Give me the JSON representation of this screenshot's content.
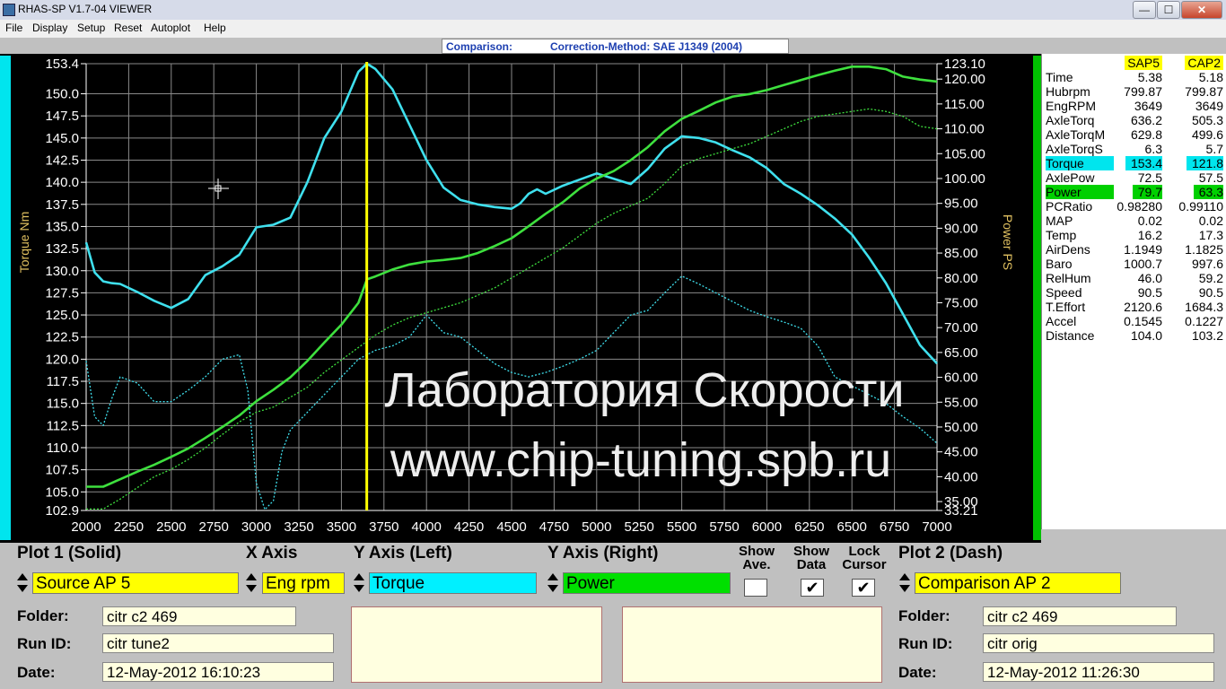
{
  "window": {
    "title": "RHAS-SP V1.7-04  VIEWER",
    "buttons": {
      "minimize": "—",
      "maximize": "☐",
      "close": "✕"
    }
  },
  "menu": [
    "File",
    "Display",
    "Setup",
    "Reset",
    "Autoplot",
    "Help"
  ],
  "heading": {
    "comparison": "Comparison:",
    "method": "Correction-Method: SAE J1349 (2004)"
  },
  "chart_data": {
    "type": "line",
    "xlabel": "",
    "ylabel_left": "Torque Nm",
    "ylabel_right": "Power PS",
    "xlim": [
      2000,
      7000
    ],
    "ylim_left": [
      102.9,
      153.4
    ],
    "ylim_right": [
      33.21,
      123.1
    ],
    "x_ticks": [
      "2000",
      "2250",
      "2500",
      "2750",
      "3000",
      "3250",
      "3500",
      "3750",
      "4000",
      "4250",
      "4500",
      "4750",
      "5000",
      "5250",
      "5500",
      "5750",
      "6000",
      "6250",
      "6500",
      "6750",
      "7000"
    ],
    "y_left_ticks": [
      "153.4",
      "150.0",
      "147.5",
      "145.0",
      "142.5",
      "140.0",
      "137.5",
      "135.0",
      "132.5",
      "130.0",
      "127.5",
      "125.0",
      "122.5",
      "120.0",
      "117.5",
      "115.0",
      "112.5",
      "110.0",
      "107.5",
      "105.0",
      "102.9"
    ],
    "y_right_ticks": [
      "123.10",
      "120.00",
      "115.00",
      "110.00",
      "105.00",
      "100.00",
      "95.00",
      "90.00",
      "85.00",
      "80.00",
      "75.00",
      "70.00",
      "65.00",
      "60.00",
      "55.00",
      "50.00",
      "45.00",
      "40.00",
      "35.00",
      "33.21"
    ],
    "cursor_rpm": 3649,
    "grid": true,
    "series": [
      {
        "name": "Torque",
        "axis": "left",
        "style": "solid",
        "color": "#3fe0ee",
        "x": [
          2000,
          2050,
          2100,
          2150,
          2200,
          2300,
          2400,
          2500,
          2600,
          2700,
          2800,
          2900,
          3000,
          3100,
          3200,
          3300,
          3400,
          3500,
          3600,
          3650,
          3700,
          3800,
          3900,
          4000,
          4100,
          4200,
          4300,
          4400,
          4500,
          4550,
          4600,
          4650,
          4700,
          4800,
          4900,
          5000,
          5100,
          5200,
          5300,
          5400,
          5500,
          5600,
          5700,
          5800,
          5900,
          6000,
          6100,
          6200,
          6300,
          6400,
          6500,
          6600,
          6700,
          6800,
          6900,
          7000
        ],
        "y": [
          133.2,
          129.8,
          128.8,
          128.6,
          128.5,
          127.6,
          126.6,
          125.8,
          126.8,
          129.5,
          130.5,
          131.8,
          134.9,
          135.2,
          136.0,
          140.0,
          145.0,
          148.0,
          152.5,
          153.4,
          152.8,
          150.5,
          146.5,
          142.5,
          139.4,
          138.0,
          137.5,
          137.2,
          137.0,
          137.6,
          138.7,
          139.2,
          138.7,
          139.6,
          140.3,
          141.0,
          140.4,
          139.8,
          141.5,
          143.8,
          145.2,
          145.0,
          144.5,
          143.6,
          142.8,
          141.6,
          139.8,
          138.7,
          137.4,
          135.9,
          134.1,
          131.5,
          128.6,
          125.1,
          121.6,
          119.5
        ]
      },
      {
        "name": "Power",
        "axis": "right",
        "style": "solid",
        "color": "#3ee03e",
        "x": [
          2000,
          2100,
          2200,
          2300,
          2400,
          2500,
          2600,
          2700,
          2800,
          2900,
          3000,
          3100,
          3200,
          3300,
          3400,
          3500,
          3600,
          3650,
          3700,
          3800,
          3900,
          4000,
          4100,
          4200,
          4300,
          4400,
          4500,
          4600,
          4700,
          4800,
          4900,
          5000,
          5100,
          5200,
          5300,
          5400,
          5500,
          5600,
          5700,
          5800,
          5900,
          6000,
          6100,
          6200,
          6300,
          6400,
          6500,
          6600,
          6700,
          6800,
          6900,
          7000
        ],
        "y": [
          38.0,
          38.0,
          39.5,
          41.0,
          42.4,
          44.0,
          45.7,
          47.8,
          50.0,
          52.3,
          55.2,
          57.5,
          60.0,
          63.3,
          67.0,
          70.6,
          75.0,
          79.7,
          80.3,
          81.7,
          82.7,
          83.3,
          83.6,
          84.0,
          85.0,
          86.4,
          88.0,
          90.4,
          92.9,
          95.2,
          98.0,
          100.0,
          101.5,
          103.7,
          106.3,
          109.5,
          112.0,
          113.6,
          115.3,
          116.5,
          117.0,
          117.8,
          118.8,
          119.8,
          120.8,
          121.7,
          122.5,
          122.5,
          122.0,
          120.5,
          119.9,
          119.5
        ]
      },
      {
        "name": "Torque",
        "axis": "left",
        "style": "dash",
        "color": "#3fe0ee",
        "x": [
          2000,
          2050,
          2100,
          2150,
          2200,
          2300,
          2400,
          2500,
          2600,
          2700,
          2800,
          2900,
          2950,
          3000,
          3050,
          3100,
          3150,
          3200,
          3300,
          3400,
          3500,
          3600,
          3700,
          3800,
          3900,
          4000,
          4100,
          4200,
          4300,
          4400,
          4500,
          4600,
          4700,
          4800,
          4900,
          5000,
          5100,
          5200,
          5300,
          5400,
          5500,
          5600,
          5700,
          5800,
          5900,
          6000,
          6100,
          6200,
          6300,
          6400,
          6500,
          6600,
          6700,
          6800,
          6900,
          7000
        ],
        "y": [
          119.8,
          113.5,
          112.5,
          115.5,
          118.0,
          117.3,
          115.2,
          115.2,
          116.5,
          118.0,
          120.0,
          120.5,
          116.5,
          106.0,
          103.0,
          104.0,
          109.5,
          112.0,
          114.0,
          116.0,
          118.0,
          120.0,
          121.0,
          121.5,
          122.5,
          125.0,
          123.0,
          122.5,
          121.0,
          119.5,
          118.5,
          118.0,
          118.5,
          119.2,
          120.0,
          121.0,
          123.0,
          125.0,
          125.5,
          127.5,
          129.4,
          128.5,
          127.5,
          126.5,
          125.5,
          124.8,
          124.2,
          123.5,
          121.5,
          118.0,
          117.0,
          116.0,
          115.0,
          113.5,
          112.2,
          110.5
        ]
      },
      {
        "name": "Power",
        "axis": "right",
        "style": "dash",
        "color": "#3ee03e",
        "x": [
          2000,
          2100,
          2200,
          2300,
          2400,
          2500,
          2600,
          2700,
          2800,
          2900,
          3000,
          3100,
          3200,
          3300,
          3400,
          3500,
          3600,
          3700,
          3800,
          3900,
          4000,
          4100,
          4200,
          4300,
          4400,
          4500,
          4600,
          4700,
          4800,
          4900,
          5000,
          5100,
          5200,
          5300,
          5400,
          5500,
          5600,
          5700,
          5800,
          5900,
          6000,
          6100,
          6200,
          6300,
          6400,
          6500,
          6600,
          6700,
          6800,
          6900,
          7000
        ],
        "y": [
          33.5,
          33.5,
          35.5,
          37.8,
          40.0,
          41.5,
          43.5,
          45.8,
          48.5,
          51.0,
          53.0,
          54.0,
          56.0,
          58.0,
          61.0,
          63.5,
          66.0,
          68.5,
          70.5,
          72.0,
          73.0,
          74.0,
          75.0,
          76.5,
          78.0,
          80.0,
          82.0,
          84.0,
          86.0,
          88.5,
          91.0,
          93.0,
          94.5,
          96.0,
          99.0,
          102.5,
          104.0,
          105.0,
          106.0,
          107.0,
          108.5,
          110.0,
          111.5,
          112.5,
          113.0,
          113.5,
          114.0,
          113.5,
          112.5,
          110.5,
          110.0
        ]
      }
    ]
  },
  "watermark": {
    "line1": "Лаборатория Скорости",
    "line2": "www.chip-tuning.spb.ru"
  },
  "data_panel": {
    "headers": [
      "SAP5",
      "CAP2"
    ],
    "rows": [
      {
        "name": "Time",
        "v1": "5.38",
        "v2": "5.18"
      },
      {
        "name": "Hubrpm",
        "v1": "799.87",
        "v2": "799.87"
      },
      {
        "name": "EngRPM",
        "v1": "3649",
        "v2": "3649"
      },
      {
        "name": "AxleTorq",
        "v1": "636.2",
        "v2": "505.3"
      },
      {
        "name": "AxleTorqM",
        "v1": "629.8",
        "v2": "499.6"
      },
      {
        "name": "AxleTorqS",
        "v1": "6.3",
        "v2": "5.7"
      },
      {
        "name": "Torque",
        "v1": "153.4",
        "v2": "121.8",
        "hl": "cyan"
      },
      {
        "name": "AxlePow",
        "v1": "72.5",
        "v2": "57.5"
      },
      {
        "name": "Power",
        "v1": "79.7",
        "v2": "63.3",
        "hl": "green"
      },
      {
        "name": "PCRatio",
        "v1": "0.98280",
        "v2": "0.99110"
      },
      {
        "name": "MAP",
        "v1": "0.02",
        "v2": "0.02"
      },
      {
        "name": "Temp",
        "v1": "16.2",
        "v2": "17.3"
      },
      {
        "name": "AirDens",
        "v1": "1.1949",
        "v2": "1.1825"
      },
      {
        "name": "Baro",
        "v1": "1000.7",
        "v2": "997.6"
      },
      {
        "name": "RelHum",
        "v1": "46.0",
        "v2": "59.2"
      },
      {
        "name": "Speed",
        "v1": "90.5",
        "v2": "90.5"
      },
      {
        "name": "T.Effort",
        "v1": "2120.6",
        "v2": "1684.3"
      },
      {
        "name": "Accel",
        "v1": "0.1545",
        "v2": "0.1227"
      },
      {
        "name": "Distance",
        "v1": "104.0",
        "v2": "103.2"
      }
    ]
  },
  "controls": {
    "plot1_label": "Plot 1 (Solid)",
    "xaxis_label": "X Axis",
    "yleft_label": "Y Axis (Left)",
    "yright_label": "Y Axis (Right)",
    "show_ave_label1": "Show",
    "show_ave_label2": "Ave.",
    "show_data_label1": "Show",
    "show_data_label2": "Data",
    "lock_cursor_label1": "Lock",
    "lock_cursor_label2": "Cursor",
    "plot2_label": "Plot 2 (Dash)",
    "plot1_value": "Source AP 5",
    "xaxis_value": "Eng rpm",
    "yleft_value": "Torque",
    "yright_value": "Power",
    "plot2_value": "Comparison AP 2",
    "show_ave_checked": "",
    "show_data_checked": "✔",
    "lock_cursor_checked": "✔"
  },
  "run1": {
    "folder_label": "Folder:",
    "folder": "citr c2 469",
    "runid_label": "Run ID:",
    "runid": "citr tune2",
    "date_label": "Date:",
    "date": "12-May-2012  16:10:23"
  },
  "run2": {
    "folder_label": "Folder:",
    "folder": "citr c2 469",
    "runid_label": "Run ID:",
    "runid": "citr orig",
    "date_label": "Date:",
    "date": "12-May-2012  11:26:30"
  }
}
